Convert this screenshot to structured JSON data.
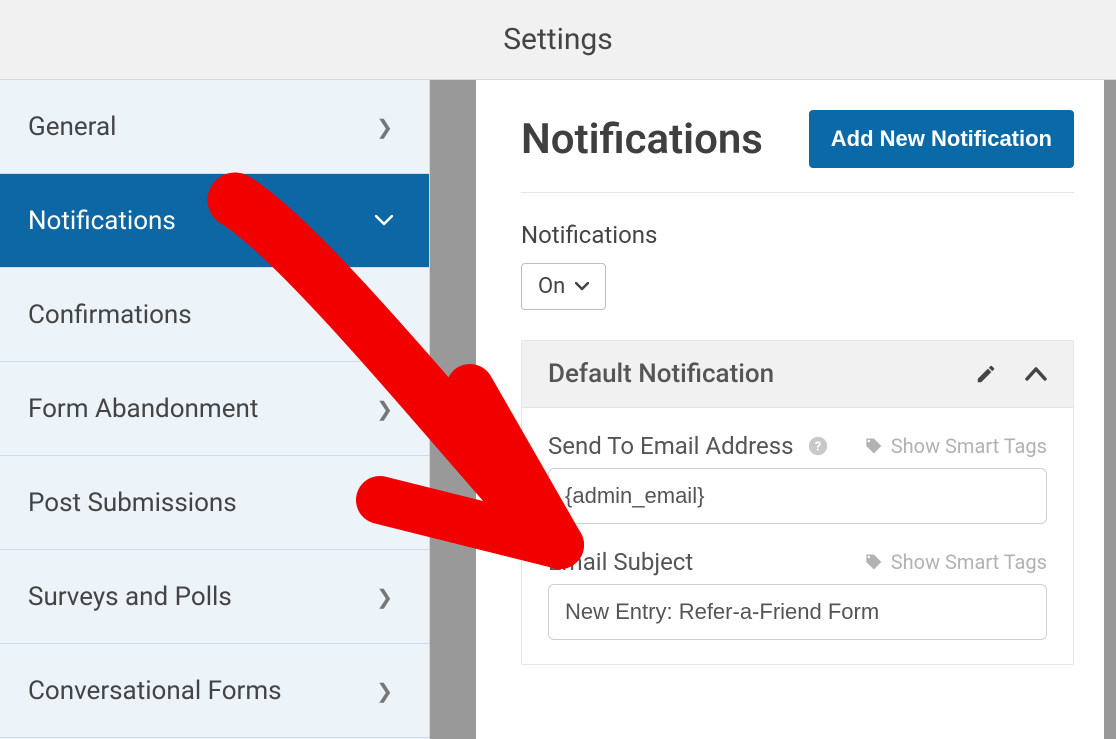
{
  "header": {
    "title": "Settings"
  },
  "sidebar": {
    "items": [
      {
        "label": "General",
        "active": false
      },
      {
        "label": "Notifications",
        "active": true
      },
      {
        "label": "Confirmations",
        "active": false
      },
      {
        "label": "Form Abandonment",
        "active": false
      },
      {
        "label": "Post Submissions",
        "active": false
      },
      {
        "label": "Surveys and Polls",
        "active": false
      },
      {
        "label": "Conversational Forms",
        "active": false
      }
    ]
  },
  "main": {
    "title": "Notifications",
    "add_button": "Add New Notification",
    "toggle_label": "Notifications",
    "toggle_value": "On",
    "card_title": "Default Notification",
    "smart_tags_label": "Show Smart Tags",
    "send_to": {
      "label": "Send To Email Address",
      "value": "{admin_email}"
    },
    "subject": {
      "label": "Email Subject",
      "value": "New Entry: Refer-a-Friend Form"
    }
  }
}
